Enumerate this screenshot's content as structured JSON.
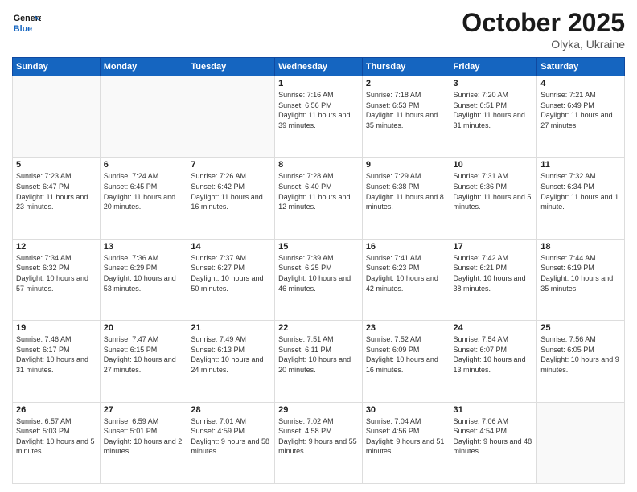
{
  "header": {
    "logo_general": "General",
    "logo_blue": "Blue",
    "month_title": "October 2025",
    "location": "Olyka, Ukraine"
  },
  "days_of_week": [
    "Sunday",
    "Monday",
    "Tuesday",
    "Wednesday",
    "Thursday",
    "Friday",
    "Saturday"
  ],
  "weeks": [
    [
      {
        "day": "",
        "empty": true
      },
      {
        "day": "",
        "empty": true
      },
      {
        "day": "",
        "empty": true
      },
      {
        "day": "1",
        "sunrise": "Sunrise: 7:16 AM",
        "sunset": "Sunset: 6:56 PM",
        "daylight": "Daylight: 11 hours and 39 minutes."
      },
      {
        "day": "2",
        "sunrise": "Sunrise: 7:18 AM",
        "sunset": "Sunset: 6:53 PM",
        "daylight": "Daylight: 11 hours and 35 minutes."
      },
      {
        "day": "3",
        "sunrise": "Sunrise: 7:20 AM",
        "sunset": "Sunset: 6:51 PM",
        "daylight": "Daylight: 11 hours and 31 minutes."
      },
      {
        "day": "4",
        "sunrise": "Sunrise: 7:21 AM",
        "sunset": "Sunset: 6:49 PM",
        "daylight": "Daylight: 11 hours and 27 minutes."
      }
    ],
    [
      {
        "day": "5",
        "sunrise": "Sunrise: 7:23 AM",
        "sunset": "Sunset: 6:47 PM",
        "daylight": "Daylight: 11 hours and 23 minutes."
      },
      {
        "day": "6",
        "sunrise": "Sunrise: 7:24 AM",
        "sunset": "Sunset: 6:45 PM",
        "daylight": "Daylight: 11 hours and 20 minutes."
      },
      {
        "day": "7",
        "sunrise": "Sunrise: 7:26 AM",
        "sunset": "Sunset: 6:42 PM",
        "daylight": "Daylight: 11 hours and 16 minutes."
      },
      {
        "day": "8",
        "sunrise": "Sunrise: 7:28 AM",
        "sunset": "Sunset: 6:40 PM",
        "daylight": "Daylight: 11 hours and 12 minutes."
      },
      {
        "day": "9",
        "sunrise": "Sunrise: 7:29 AM",
        "sunset": "Sunset: 6:38 PM",
        "daylight": "Daylight: 11 hours and 8 minutes."
      },
      {
        "day": "10",
        "sunrise": "Sunrise: 7:31 AM",
        "sunset": "Sunset: 6:36 PM",
        "daylight": "Daylight: 11 hours and 5 minutes."
      },
      {
        "day": "11",
        "sunrise": "Sunrise: 7:32 AM",
        "sunset": "Sunset: 6:34 PM",
        "daylight": "Daylight: 11 hours and 1 minute."
      }
    ],
    [
      {
        "day": "12",
        "sunrise": "Sunrise: 7:34 AM",
        "sunset": "Sunset: 6:32 PM",
        "daylight": "Daylight: 10 hours and 57 minutes."
      },
      {
        "day": "13",
        "sunrise": "Sunrise: 7:36 AM",
        "sunset": "Sunset: 6:29 PM",
        "daylight": "Daylight: 10 hours and 53 minutes."
      },
      {
        "day": "14",
        "sunrise": "Sunrise: 7:37 AM",
        "sunset": "Sunset: 6:27 PM",
        "daylight": "Daylight: 10 hours and 50 minutes."
      },
      {
        "day": "15",
        "sunrise": "Sunrise: 7:39 AM",
        "sunset": "Sunset: 6:25 PM",
        "daylight": "Daylight: 10 hours and 46 minutes."
      },
      {
        "day": "16",
        "sunrise": "Sunrise: 7:41 AM",
        "sunset": "Sunset: 6:23 PM",
        "daylight": "Daylight: 10 hours and 42 minutes."
      },
      {
        "day": "17",
        "sunrise": "Sunrise: 7:42 AM",
        "sunset": "Sunset: 6:21 PM",
        "daylight": "Daylight: 10 hours and 38 minutes."
      },
      {
        "day": "18",
        "sunrise": "Sunrise: 7:44 AM",
        "sunset": "Sunset: 6:19 PM",
        "daylight": "Daylight: 10 hours and 35 minutes."
      }
    ],
    [
      {
        "day": "19",
        "sunrise": "Sunrise: 7:46 AM",
        "sunset": "Sunset: 6:17 PM",
        "daylight": "Daylight: 10 hours and 31 minutes."
      },
      {
        "day": "20",
        "sunrise": "Sunrise: 7:47 AM",
        "sunset": "Sunset: 6:15 PM",
        "daylight": "Daylight: 10 hours and 27 minutes."
      },
      {
        "day": "21",
        "sunrise": "Sunrise: 7:49 AM",
        "sunset": "Sunset: 6:13 PM",
        "daylight": "Daylight: 10 hours and 24 minutes."
      },
      {
        "day": "22",
        "sunrise": "Sunrise: 7:51 AM",
        "sunset": "Sunset: 6:11 PM",
        "daylight": "Daylight: 10 hours and 20 minutes."
      },
      {
        "day": "23",
        "sunrise": "Sunrise: 7:52 AM",
        "sunset": "Sunset: 6:09 PM",
        "daylight": "Daylight: 10 hours and 16 minutes."
      },
      {
        "day": "24",
        "sunrise": "Sunrise: 7:54 AM",
        "sunset": "Sunset: 6:07 PM",
        "daylight": "Daylight: 10 hours and 13 minutes."
      },
      {
        "day": "25",
        "sunrise": "Sunrise: 7:56 AM",
        "sunset": "Sunset: 6:05 PM",
        "daylight": "Daylight: 10 hours and 9 minutes."
      }
    ],
    [
      {
        "day": "26",
        "sunrise": "Sunrise: 6:57 AM",
        "sunset": "Sunset: 5:03 PM",
        "daylight": "Daylight: 10 hours and 5 minutes."
      },
      {
        "day": "27",
        "sunrise": "Sunrise: 6:59 AM",
        "sunset": "Sunset: 5:01 PM",
        "daylight": "Daylight: 10 hours and 2 minutes."
      },
      {
        "day": "28",
        "sunrise": "Sunrise: 7:01 AM",
        "sunset": "Sunset: 4:59 PM",
        "daylight": "Daylight: 9 hours and 58 minutes."
      },
      {
        "day": "29",
        "sunrise": "Sunrise: 7:02 AM",
        "sunset": "Sunset: 4:58 PM",
        "daylight": "Daylight: 9 hours and 55 minutes."
      },
      {
        "day": "30",
        "sunrise": "Sunrise: 7:04 AM",
        "sunset": "Sunset: 4:56 PM",
        "daylight": "Daylight: 9 hours and 51 minutes."
      },
      {
        "day": "31",
        "sunrise": "Sunrise: 7:06 AM",
        "sunset": "Sunset: 4:54 PM",
        "daylight": "Daylight: 9 hours and 48 minutes."
      },
      {
        "day": "",
        "empty": true
      }
    ]
  ]
}
